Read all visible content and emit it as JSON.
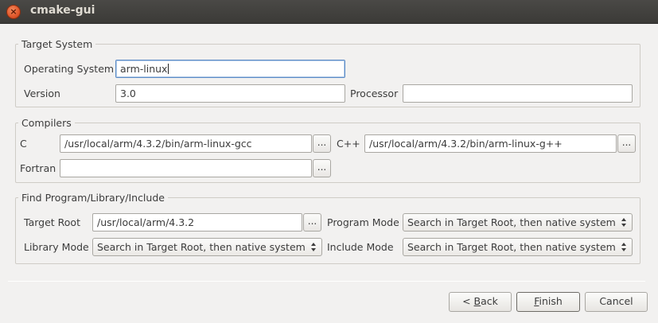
{
  "window": {
    "title": "cmake-gui"
  },
  "target_system": {
    "group_title": "Target System",
    "os_label": "Operating System",
    "os_value": "arm-linux",
    "version_label": "Version",
    "version_value": "3.0",
    "processor_label": "Processor",
    "processor_value": ""
  },
  "compilers": {
    "group_title": "Compilers",
    "c_label": "C",
    "c_value": "/usr/local/arm/4.3.2/bin/arm-linux-gcc",
    "cpp_label": "C++",
    "cpp_value": "/usr/local/arm/4.3.2/bin/arm-linux-g++",
    "fortran_label": "Fortran",
    "fortran_value": "",
    "browse_label": "..."
  },
  "find": {
    "group_title": "Find Program/Library/Include",
    "target_root_label": "Target Root",
    "target_root_value": "/usr/local/arm/4.3.2",
    "program_mode_label": "Program Mode",
    "program_mode_value": "Search in Target Root, then native system",
    "library_mode_label": "Library Mode",
    "library_mode_value": "Search in Target Root, then native system",
    "include_mode_label": "Include Mode",
    "include_mode_value": "Search in Target Root, then native system"
  },
  "buttons": {
    "back_prefix": "< ",
    "back_mnemonic": "B",
    "back_rest": "ack",
    "finish_mnemonic": "F",
    "finish_rest": "inish",
    "cancel": "Cancel"
  },
  "colors": {
    "window_bg": "#f2f1f0",
    "titlebar": "#3c3b37",
    "close_button": "#e0562a",
    "focus": "#5b8bc6"
  }
}
